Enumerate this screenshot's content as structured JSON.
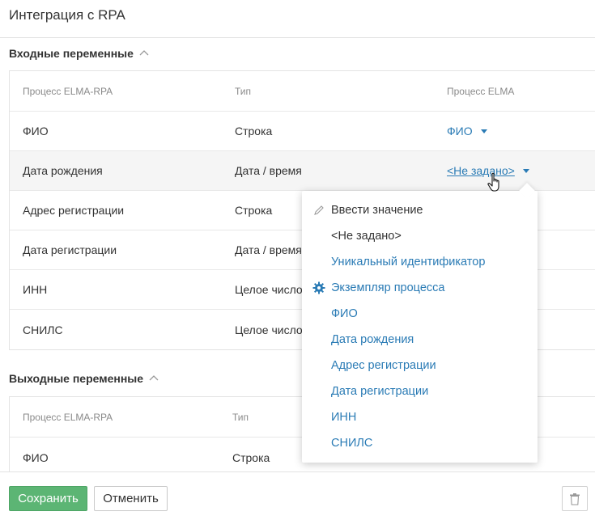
{
  "header": {
    "title": "Интеграция с RPA"
  },
  "input_section": {
    "title": "Входные переменные",
    "columns": [
      "Процесс ELMA-RPA",
      "Тип",
      "Процесс ELMA"
    ],
    "rows": [
      {
        "rpa": "ФИО",
        "type": "Строка",
        "elma": "ФИО"
      },
      {
        "rpa": "Дата рождения",
        "type": "Дата / время",
        "elma": "<Не задано>"
      },
      {
        "rpa": "Адрес регистрации",
        "type": "Строка",
        "elma": ""
      },
      {
        "rpa": "Дата регистрации",
        "type": "Дата / время",
        "elma": ""
      },
      {
        "rpa": "ИНН",
        "type": "Целое число",
        "elma": ""
      },
      {
        "rpa": "СНИЛС",
        "type": "Целое число",
        "elma": ""
      }
    ]
  },
  "output_section": {
    "title": "Выходные переменные",
    "columns": [
      "Процесс ELMA-RPA",
      "Тип"
    ],
    "rows": [
      {
        "rpa": "ФИО",
        "type": "Строка"
      }
    ]
  },
  "dropdown": {
    "items": [
      {
        "label": "Ввести значение",
        "icon": "pencil-icon"
      },
      {
        "label": "<Не задано>",
        "icon": ""
      },
      {
        "label": "Уникальный идентификатор",
        "icon": ""
      },
      {
        "label": "Экземпляр процесса",
        "icon": "gear-icon"
      },
      {
        "label": "ФИО",
        "icon": ""
      },
      {
        "label": "Дата рождения",
        "icon": ""
      },
      {
        "label": "Адрес регистрации",
        "icon": ""
      },
      {
        "label": "Дата регистрации",
        "icon": ""
      },
      {
        "label": "ИНН",
        "icon": ""
      },
      {
        "label": "СНИЛС",
        "icon": ""
      }
    ]
  },
  "footer": {
    "save_label": "Сохранить",
    "cancel_label": "Отменить",
    "delete_icon": "trash-icon"
  },
  "colors": {
    "link": "#2a7bb5",
    "save_button": "#5cb574",
    "border": "#e3e3e3"
  }
}
